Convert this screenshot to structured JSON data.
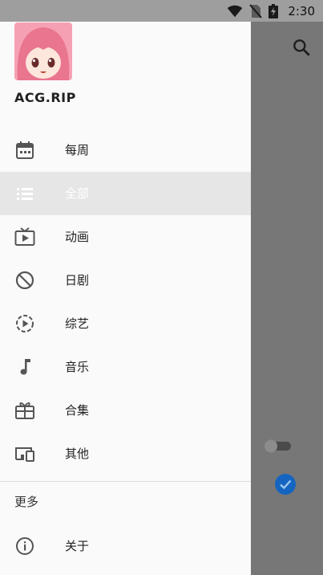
{
  "status_bar": {
    "time": "2:30",
    "icons": [
      "wifi-icon",
      "no-sim-icon",
      "battery-charging-icon"
    ]
  },
  "app": {
    "name": "ACG.RIP"
  },
  "nav": {
    "items": [
      {
        "label": "每周",
        "icon": "calendar-icon",
        "selected": false
      },
      {
        "label": "全部",
        "icon": "list-icon",
        "selected": true
      },
      {
        "label": "动画",
        "icon": "tv-play-icon",
        "selected": false
      },
      {
        "label": "日剧",
        "icon": "block-icon",
        "selected": false
      },
      {
        "label": "综艺",
        "icon": "play-circle-dashed-icon",
        "selected": false
      },
      {
        "label": "音乐",
        "icon": "music-note-icon",
        "selected": false
      },
      {
        "label": "合集",
        "icon": "collection-icon",
        "selected": false
      },
      {
        "label": "其他",
        "icon": "devices-icon",
        "selected": false
      }
    ],
    "more_header": "更多",
    "about": {
      "label": "关于",
      "icon": "info-icon"
    }
  },
  "background": {
    "toggle_on": false,
    "checkbox_checked": true
  },
  "colors": {
    "scrim": "#777777",
    "selected_bg": "#e6e6e6",
    "accent": "#1565c0"
  }
}
